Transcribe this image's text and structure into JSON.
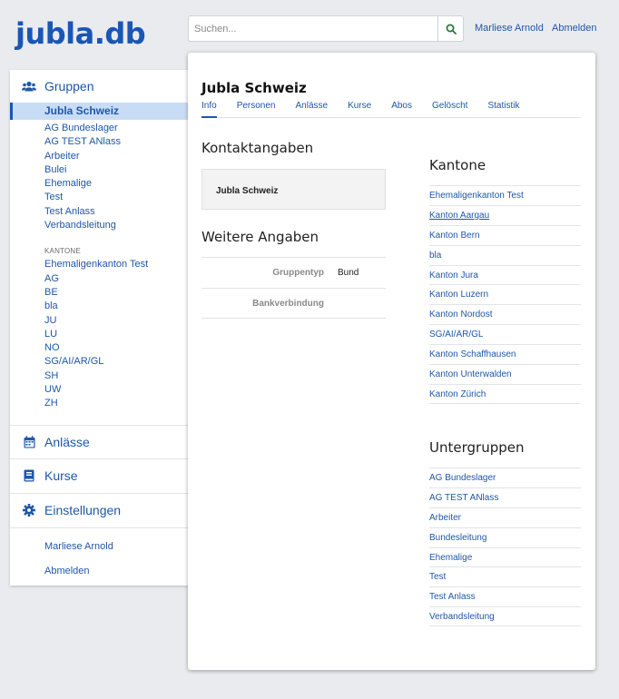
{
  "header": {
    "logo": "jubla.db",
    "search_placeholder": "Suchen...",
    "user_name": "Marliese Arnold",
    "logout": "Abmelden"
  },
  "sidebar": {
    "groups_label": "Gruppen",
    "groups": [
      "Jubla Schweiz",
      "AG Bundeslager",
      "AG TEST ANlass",
      "Arbeiter",
      "Bulei",
      "Ehemalige",
      "Test",
      "Test Anlass",
      "Verbandsleitung"
    ],
    "kantone_heading": "KANTONE",
    "kantone": [
      "Ehemaligenkanton Test",
      "AG",
      "BE",
      "bla",
      "JU",
      "LU",
      "NO",
      "SG/AI/AR/GL",
      "SH",
      "UW",
      "ZH"
    ],
    "events_label": "Anlässe",
    "courses_label": "Kurse",
    "settings_label": "Einstellungen",
    "user_name": "Marliese Arnold",
    "logout": "Abmelden"
  },
  "main": {
    "title": "Jubla Schweiz",
    "tabs": [
      "Info",
      "Personen",
      "Anlässe",
      "Kurse",
      "Abos",
      "Gelöscht",
      "Statistik"
    ],
    "contact_heading": "Kontaktangaben",
    "contact_name": "Jubla Schweiz",
    "more_heading": "Weitere Angaben",
    "attributes": [
      {
        "label": "Gruppentyp",
        "value": "Bund"
      },
      {
        "label": "Bankverbindung",
        "value": ""
      }
    ],
    "kantone_heading": "Kantone",
    "kantone": [
      "Ehemaligenkanton Test",
      "Kanton Aargau",
      "Kanton Bern",
      "bla",
      "Kanton Jura",
      "Kanton Luzern",
      "Kanton Nordost",
      "SG/AI/AR/GL",
      "Kanton Schaffhausen",
      "Kanton Unterwalden",
      "Kanton Zürich"
    ],
    "subgroups_heading": "Untergruppen",
    "subgroups": [
      "AG Bundeslager",
      "AG TEST ANlass",
      "Arbeiter",
      "Bundesleitung",
      "Ehemalige",
      "Test",
      "Test Anlass",
      "Verbandsleitung"
    ]
  },
  "colors": {
    "brand": "#1a56b4",
    "link": "#1f57a6",
    "active_bg": "#c9dcf5",
    "search_icon": "#2a7a3a"
  }
}
